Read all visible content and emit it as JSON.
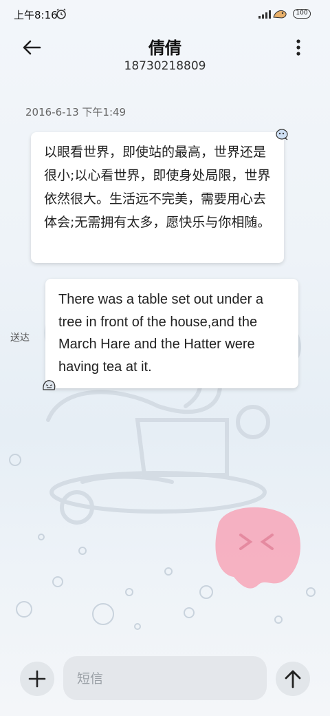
{
  "status_bar": {
    "time": "上午8:16",
    "battery_level": "100",
    "icons": [
      "alarm-icon",
      "signal-icon",
      "bird-icon"
    ]
  },
  "header": {
    "back_icon": "back-arrow-icon",
    "contact_name": "倩倩",
    "phone_number": "18730218809",
    "menu_icon": "more-vertical-icon"
  },
  "conversation": {
    "timestamp": "2016-6-13 下午1:49",
    "messages": [
      {
        "direction": "received",
        "text": "以眼看世界，即使站的最高，世界还是很小;以心看世界，即使身处局限，世界依然很大。生活远不完美，需要用心去体会;无需拥有太多，愿快乐与你相随。",
        "avatar_icon": "bird-sticker-icon"
      },
      {
        "direction": "sent",
        "text": "There was a table set out under a tree in front of the house,and the March Hare and the Hatter were having tea at it.",
        "status": "送达",
        "avatar_icon": "ghost-sticker-icon"
      }
    ]
  },
  "composer": {
    "attach_icon": "plus-icon",
    "input_value": "",
    "input_placeholder": "短信",
    "send_icon": "arrow-up-icon"
  },
  "colors": {
    "background": "#eef3f8",
    "bubble": "#ffffff",
    "button": "#e2e6ea",
    "accent_caret": "#2a6df4",
    "decor_pink": "#f7a6b8"
  }
}
